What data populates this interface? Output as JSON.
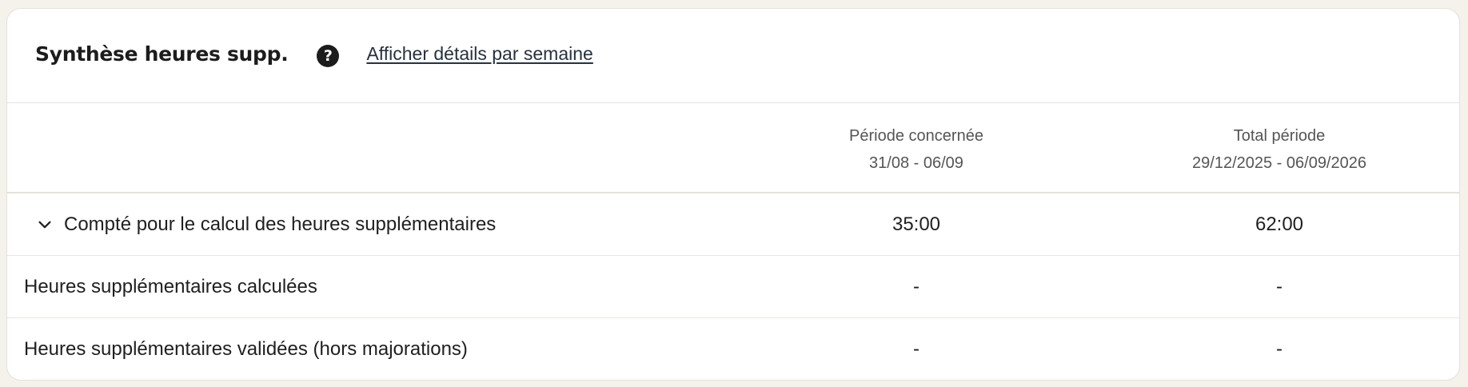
{
  "header": {
    "title": "Synthèse heures supp.",
    "help_icon": "question-circle-icon",
    "details_link": "Afficher détails par semaine"
  },
  "columns": [
    {
      "title": "Période concernée",
      "range": "31/08 - 06/09"
    },
    {
      "title": "Total période",
      "range": "29/12/2025 - 06/09/2026"
    }
  ],
  "rows": [
    {
      "label": "Compté pour le calcul des heures supplémentaires",
      "expand_icon": "chevron-down-icon",
      "values": [
        "35:00",
        "62:00"
      ]
    },
    {
      "label": "Heures supplémentaires calculées",
      "values": [
        "-",
        "-"
      ]
    },
    {
      "label": "Heures supplémentaires validées (hors majorations)",
      "values": [
        "-",
        "-"
      ]
    }
  ]
}
